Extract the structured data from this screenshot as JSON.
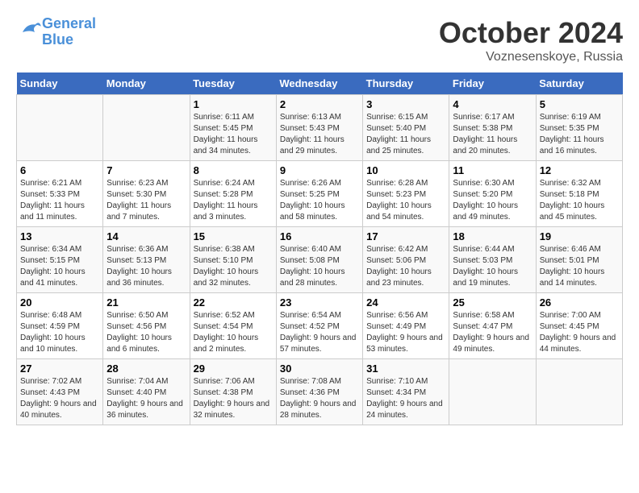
{
  "logo": {
    "line1": "General",
    "line2": "Blue"
  },
  "title": "October 2024",
  "location": "Voznesenskoye, Russia",
  "headers": [
    "Sunday",
    "Monday",
    "Tuesday",
    "Wednesday",
    "Thursday",
    "Friday",
    "Saturday"
  ],
  "rows": [
    [
      {
        "day": "",
        "sunrise": "",
        "sunset": "",
        "daylight": ""
      },
      {
        "day": "",
        "sunrise": "",
        "sunset": "",
        "daylight": ""
      },
      {
        "day": "1",
        "sunrise": "Sunrise: 6:11 AM",
        "sunset": "Sunset: 5:45 PM",
        "daylight": "Daylight: 11 hours and 34 minutes."
      },
      {
        "day": "2",
        "sunrise": "Sunrise: 6:13 AM",
        "sunset": "Sunset: 5:43 PM",
        "daylight": "Daylight: 11 hours and 29 minutes."
      },
      {
        "day": "3",
        "sunrise": "Sunrise: 6:15 AM",
        "sunset": "Sunset: 5:40 PM",
        "daylight": "Daylight: 11 hours and 25 minutes."
      },
      {
        "day": "4",
        "sunrise": "Sunrise: 6:17 AM",
        "sunset": "Sunset: 5:38 PM",
        "daylight": "Daylight: 11 hours and 20 minutes."
      },
      {
        "day": "5",
        "sunrise": "Sunrise: 6:19 AM",
        "sunset": "Sunset: 5:35 PM",
        "daylight": "Daylight: 11 hours and 16 minutes."
      }
    ],
    [
      {
        "day": "6",
        "sunrise": "Sunrise: 6:21 AM",
        "sunset": "Sunset: 5:33 PM",
        "daylight": "Daylight: 11 hours and 11 minutes."
      },
      {
        "day": "7",
        "sunrise": "Sunrise: 6:23 AM",
        "sunset": "Sunset: 5:30 PM",
        "daylight": "Daylight: 11 hours and 7 minutes."
      },
      {
        "day": "8",
        "sunrise": "Sunrise: 6:24 AM",
        "sunset": "Sunset: 5:28 PM",
        "daylight": "Daylight: 11 hours and 3 minutes."
      },
      {
        "day": "9",
        "sunrise": "Sunrise: 6:26 AM",
        "sunset": "Sunset: 5:25 PM",
        "daylight": "Daylight: 10 hours and 58 minutes."
      },
      {
        "day": "10",
        "sunrise": "Sunrise: 6:28 AM",
        "sunset": "Sunset: 5:23 PM",
        "daylight": "Daylight: 10 hours and 54 minutes."
      },
      {
        "day": "11",
        "sunrise": "Sunrise: 6:30 AM",
        "sunset": "Sunset: 5:20 PM",
        "daylight": "Daylight: 10 hours and 49 minutes."
      },
      {
        "day": "12",
        "sunrise": "Sunrise: 6:32 AM",
        "sunset": "Sunset: 5:18 PM",
        "daylight": "Daylight: 10 hours and 45 minutes."
      }
    ],
    [
      {
        "day": "13",
        "sunrise": "Sunrise: 6:34 AM",
        "sunset": "Sunset: 5:15 PM",
        "daylight": "Daylight: 10 hours and 41 minutes."
      },
      {
        "day": "14",
        "sunrise": "Sunrise: 6:36 AM",
        "sunset": "Sunset: 5:13 PM",
        "daylight": "Daylight: 10 hours and 36 minutes."
      },
      {
        "day": "15",
        "sunrise": "Sunrise: 6:38 AM",
        "sunset": "Sunset: 5:10 PM",
        "daylight": "Daylight: 10 hours and 32 minutes."
      },
      {
        "day": "16",
        "sunrise": "Sunrise: 6:40 AM",
        "sunset": "Sunset: 5:08 PM",
        "daylight": "Daylight: 10 hours and 28 minutes."
      },
      {
        "day": "17",
        "sunrise": "Sunrise: 6:42 AM",
        "sunset": "Sunset: 5:06 PM",
        "daylight": "Daylight: 10 hours and 23 minutes."
      },
      {
        "day": "18",
        "sunrise": "Sunrise: 6:44 AM",
        "sunset": "Sunset: 5:03 PM",
        "daylight": "Daylight: 10 hours and 19 minutes."
      },
      {
        "day": "19",
        "sunrise": "Sunrise: 6:46 AM",
        "sunset": "Sunset: 5:01 PM",
        "daylight": "Daylight: 10 hours and 14 minutes."
      }
    ],
    [
      {
        "day": "20",
        "sunrise": "Sunrise: 6:48 AM",
        "sunset": "Sunset: 4:59 PM",
        "daylight": "Daylight: 10 hours and 10 minutes."
      },
      {
        "day": "21",
        "sunrise": "Sunrise: 6:50 AM",
        "sunset": "Sunset: 4:56 PM",
        "daylight": "Daylight: 10 hours and 6 minutes."
      },
      {
        "day": "22",
        "sunrise": "Sunrise: 6:52 AM",
        "sunset": "Sunset: 4:54 PM",
        "daylight": "Daylight: 10 hours and 2 minutes."
      },
      {
        "day": "23",
        "sunrise": "Sunrise: 6:54 AM",
        "sunset": "Sunset: 4:52 PM",
        "daylight": "Daylight: 9 hours and 57 minutes."
      },
      {
        "day": "24",
        "sunrise": "Sunrise: 6:56 AM",
        "sunset": "Sunset: 4:49 PM",
        "daylight": "Daylight: 9 hours and 53 minutes."
      },
      {
        "day": "25",
        "sunrise": "Sunrise: 6:58 AM",
        "sunset": "Sunset: 4:47 PM",
        "daylight": "Daylight: 9 hours and 49 minutes."
      },
      {
        "day": "26",
        "sunrise": "Sunrise: 7:00 AM",
        "sunset": "Sunset: 4:45 PM",
        "daylight": "Daylight: 9 hours and 44 minutes."
      }
    ],
    [
      {
        "day": "27",
        "sunrise": "Sunrise: 7:02 AM",
        "sunset": "Sunset: 4:43 PM",
        "daylight": "Daylight: 9 hours and 40 minutes."
      },
      {
        "day": "28",
        "sunrise": "Sunrise: 7:04 AM",
        "sunset": "Sunset: 4:40 PM",
        "daylight": "Daylight: 9 hours and 36 minutes."
      },
      {
        "day": "29",
        "sunrise": "Sunrise: 7:06 AM",
        "sunset": "Sunset: 4:38 PM",
        "daylight": "Daylight: 9 hours and 32 minutes."
      },
      {
        "day": "30",
        "sunrise": "Sunrise: 7:08 AM",
        "sunset": "Sunset: 4:36 PM",
        "daylight": "Daylight: 9 hours and 28 minutes."
      },
      {
        "day": "31",
        "sunrise": "Sunrise: 7:10 AM",
        "sunset": "Sunset: 4:34 PM",
        "daylight": "Daylight: 9 hours and 24 minutes."
      },
      {
        "day": "",
        "sunrise": "",
        "sunset": "",
        "daylight": ""
      },
      {
        "day": "",
        "sunrise": "",
        "sunset": "",
        "daylight": ""
      }
    ]
  ]
}
